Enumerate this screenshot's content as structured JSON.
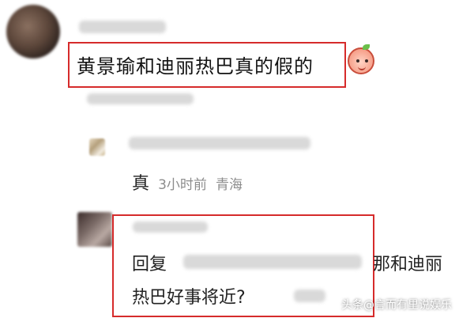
{
  "comment": {
    "text": "黄景瑜和迪丽热巴真的假的"
  },
  "sub_reply": {
    "text": "真",
    "time": "3小时前",
    "location": "青海"
  },
  "reply": {
    "prefix": "回复",
    "line1_tail": "那和迪丽",
    "line2": "热巴好事将近?"
  },
  "watermark": "头条@言而有里说娱乐",
  "colors": {
    "highlight_box": "#d62b2b",
    "meta_text": "#8c8c8c"
  }
}
